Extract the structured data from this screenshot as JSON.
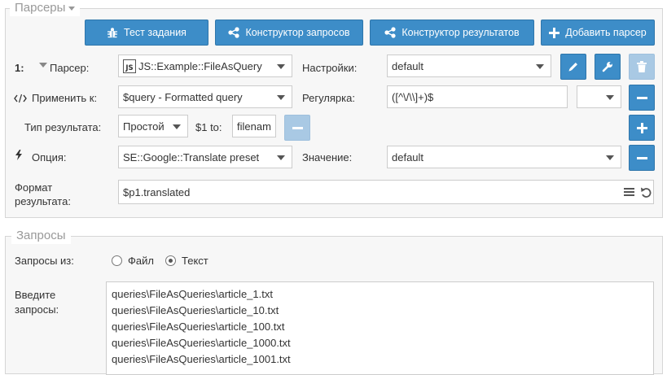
{
  "parsers_panel": {
    "legend": "Парсеры",
    "buttons": {
      "test_task": "Тест задания",
      "query_builder": "Конструктор запросов",
      "result_builder": "Конструктор результатов",
      "add_parser": "Добавить парсер"
    },
    "row_number": "1:",
    "parser_label": "Парсер:",
    "parser_icon_text": "JS",
    "parser_value": "JS::Example::FileAsQuery",
    "settings_label": "Настройки:",
    "settings_value": "default",
    "apply_label": "Применить к:",
    "apply_value": "$query - Formatted query",
    "regex_label": "Регулярка:",
    "regex_value": "([^\\/\\\\]+)$",
    "regex_flags_value": "",
    "result_type_label": "Тип результата:",
    "result_type_value": "Простой",
    "to_label": "$1 to:",
    "to_value": "filenam",
    "option_label": "Опция:",
    "option_value": "SE::Google::Translate preset",
    "value_label": "Значение:",
    "value_value": "default",
    "format_label_line1": "Формат",
    "format_label_line2": "результата:",
    "format_value": "$p1.translated"
  },
  "queries_panel": {
    "legend": "Запросы",
    "source_label": "Запросы из:",
    "source_options": [
      "Файл",
      "Текст"
    ],
    "source_selected": "Текст",
    "enter_label_line1": "Введите",
    "enter_label_line2": "запросы:",
    "queries": [
      "queries\\FileAsQueries\\article_1.txt",
      "queries\\FileAsQueries\\article_10.txt",
      "queries\\FileAsQueries\\article_100.txt",
      "queries\\FileAsQueries\\article_1000.txt",
      "queries\\FileAsQueries\\article_1001.txt"
    ]
  },
  "colors": {
    "button_primary": "#3d8dc8",
    "button_disabled": "#a9c9e4",
    "panel_background": "#f7f7f7",
    "legend_text": "#999999"
  },
  "icons": {
    "test_task": "bug-icon",
    "query_builder": "share-icon",
    "result_builder": "share-icon",
    "add_parser": "plus-icon",
    "edit": "pencil-icon",
    "settings": "wrench-icon",
    "delete": "trash-icon",
    "remove": "minus-icon",
    "add": "plus-icon",
    "code": "code-icon",
    "option": "bolt-icon",
    "collapse": "caret-down-icon",
    "template_list": "list-icon",
    "reset": "undo-icon"
  }
}
